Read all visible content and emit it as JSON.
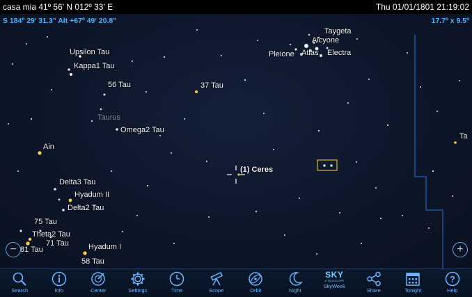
{
  "status": {
    "location": "casa mia  41º 56' N 012º 33' E",
    "datetime": "Thu 01/01/1801  21:19:02"
  },
  "overlay": {
    "coords": "S 184º 29' 31.3\" Alt +67º 49' 20.8\"",
    "fov": "17.7º x  9.5º"
  },
  "labels": {
    "taygeta": "Taygeta",
    "alcyone": "Alcyone",
    "pleione": "Pleione",
    "atlas": "Atlas",
    "electra": "Electra",
    "upsilon_tau": "Upsilon Tau",
    "kappa1_tau": "Kappa1 Tau",
    "tau56": "56 Tau",
    "tau37": "37 Tau",
    "taurus": "Taurus",
    "omega2_tau": "Omega2 Tau",
    "ain": "Ain",
    "ceres": "(1) Ceres",
    "delta3_tau": "Delta3 Tau",
    "hyadum_ii": "Hyadum II",
    "delta2_tau": "Delta2 Tau",
    "tau75": "75 Tau",
    "theta2_tau": "Theta2 Tau",
    "tau71": "71 Tau",
    "tau81": "81 Tau",
    "hyadum_i": "Hyadum I",
    "tau58": "58 Tau",
    "edge_ta": "Ta"
  },
  "zoom": {
    "out": "−",
    "in": "+"
  },
  "toolbar": [
    {
      "name": "search",
      "label": "Search",
      "icon": "search-icon"
    },
    {
      "name": "info",
      "label": "Info",
      "icon": "info-icon"
    },
    {
      "name": "center",
      "label": "Center",
      "icon": "center-icon"
    },
    {
      "name": "settings",
      "label": "Settings",
      "icon": "gear-icon"
    },
    {
      "name": "time",
      "label": "Time",
      "icon": "clock-icon"
    },
    {
      "name": "scope",
      "label": "Scope",
      "icon": "telescope-icon"
    },
    {
      "name": "orbit",
      "label": "Orbit",
      "icon": "orbit-icon"
    },
    {
      "name": "night",
      "label": "Night",
      "icon": "moon-icon"
    },
    {
      "name": "skyweek",
      "label": "SkyWeek",
      "icon": "sky-telescope-logo",
      "brand": "SKY",
      "brand_sub": "& TELESCOPE"
    },
    {
      "name": "share",
      "label": "Share",
      "icon": "share-icon"
    },
    {
      "name": "tonight",
      "label": "Tonight",
      "icon": "calendar-icon"
    },
    {
      "name": "help",
      "label": "Help",
      "icon": "help-icon"
    }
  ]
}
